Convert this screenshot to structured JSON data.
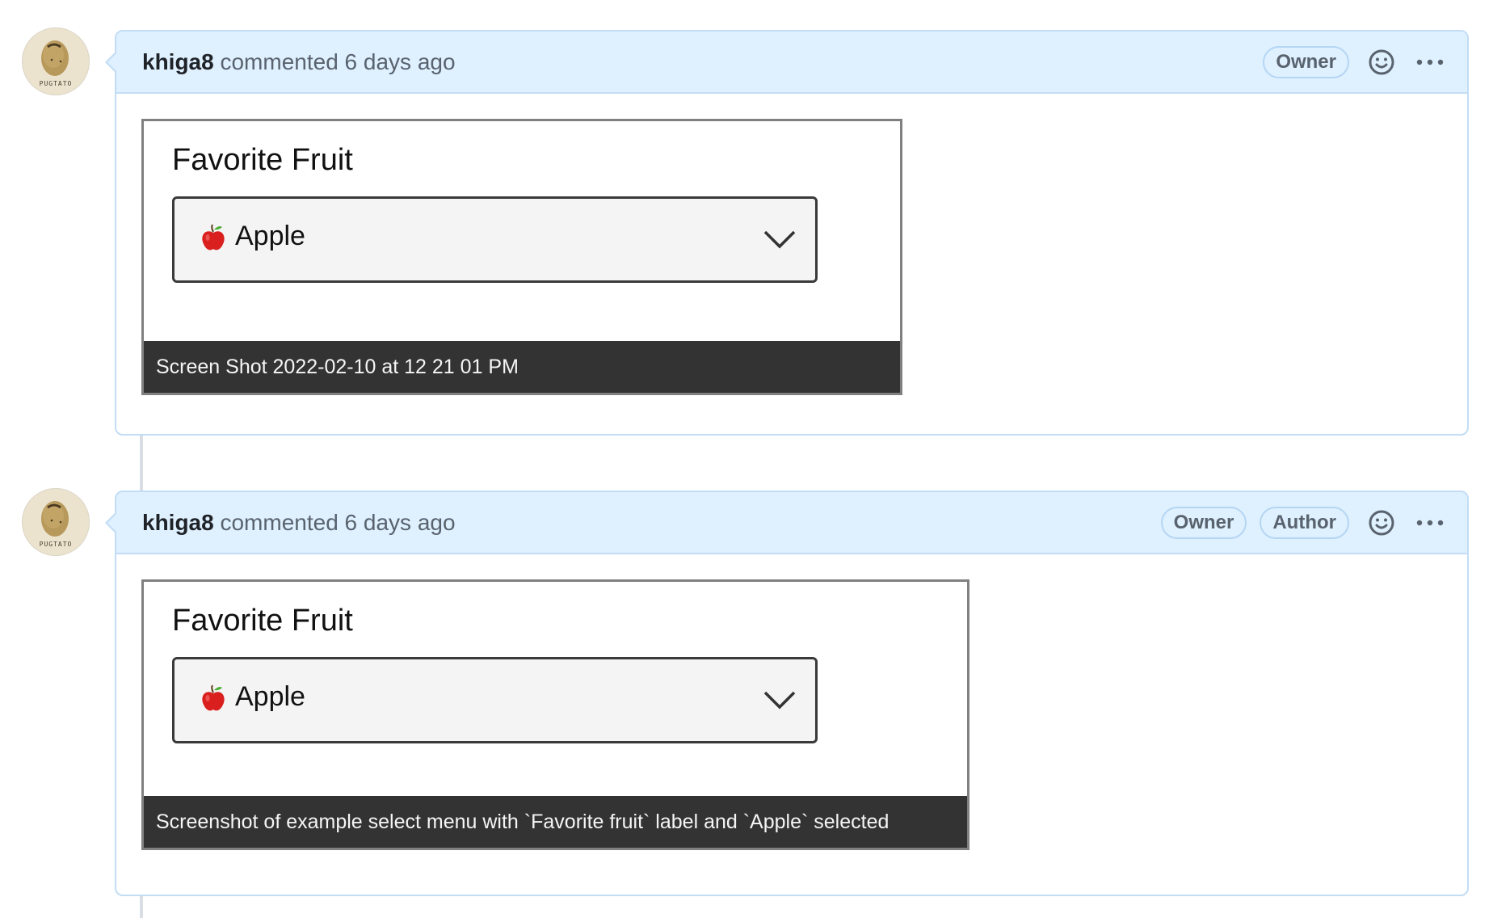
{
  "timeline": {
    "comments": [
      {
        "author": "khiga8",
        "action_text": "commented 6 days ago",
        "avatar_label": "PUGTATO",
        "badges": [
          "Owner"
        ],
        "attachment": {
          "form_label": "Favorite Fruit",
          "select_emoji": "red-apple-emoji",
          "select_value": "Apple",
          "caption": "Screen Shot 2022-02-10 at 12 21 01 PM"
        }
      },
      {
        "author": "khiga8",
        "action_text": "commented 6 days ago",
        "avatar_label": "PUGTATO",
        "badges": [
          "Owner",
          "Author"
        ],
        "attachment": {
          "form_label": "Favorite Fruit",
          "select_emoji": "red-apple-emoji",
          "select_value": "Apple",
          "caption": "Screenshot of example select menu with `Favorite fruit` label and `Apple` selected"
        }
      }
    ]
  },
  "icons": {
    "reaction": "smiley-icon",
    "more": "kebab-horizontal-icon",
    "dropdown": "chevron-down-icon"
  },
  "colors": {
    "header_bg": "#dff0ff",
    "border": "#c2ddf5",
    "text_muted": "#59636e",
    "text_primary": "#1f2328",
    "caption_bg": "#333333",
    "select_bg": "#f4f4f4"
  }
}
